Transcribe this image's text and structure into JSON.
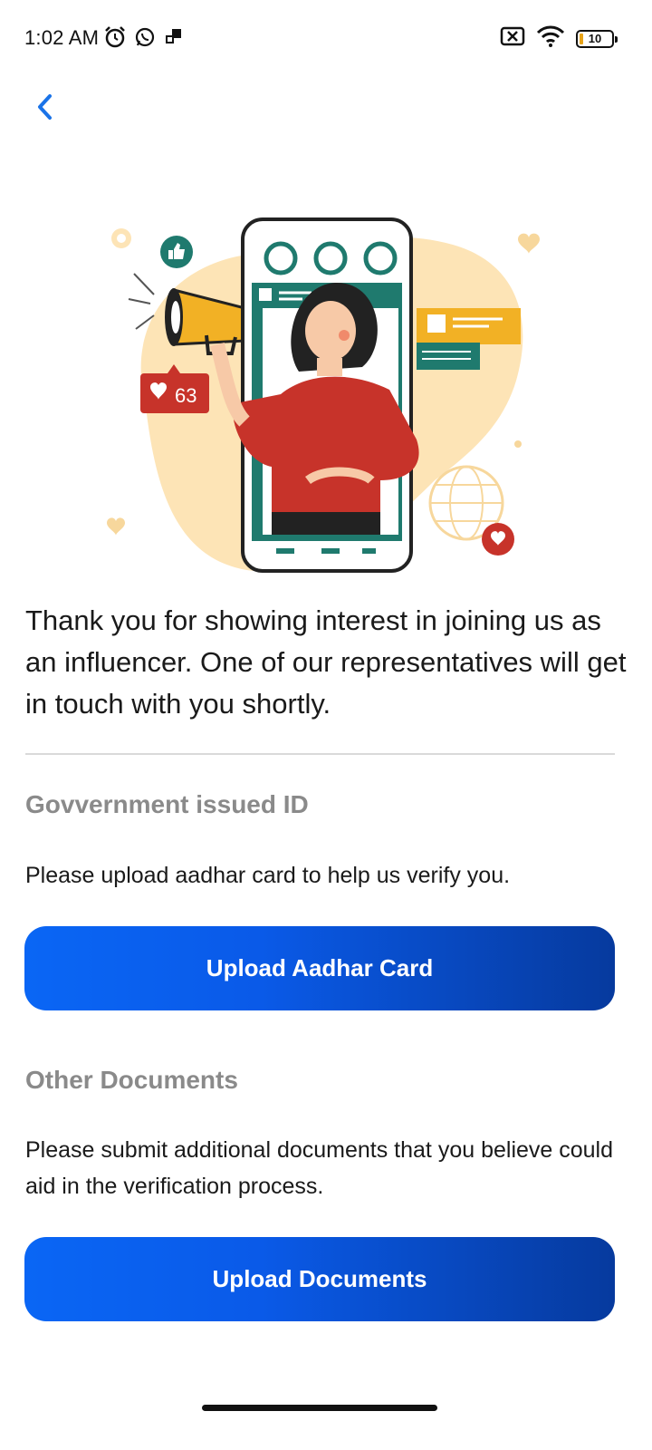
{
  "status_bar": {
    "time": "1:02 AM",
    "battery_level": "10",
    "icons": [
      "alarm-icon",
      "whatsapp-icon",
      "notification-icon",
      "no-sim-icon",
      "wifi-icon",
      "battery-icon"
    ]
  },
  "nav": {
    "back_icon": "chevron-left-icon",
    "accent_color": "#1a73e8"
  },
  "illustration": {
    "like_count": "63"
  },
  "intro_text": "Thank you for showing interest in joining us as an influencer. One of our representatives will get in touch with you shortly.",
  "sections": [
    {
      "title": "Govvernment issued ID",
      "description": "Please upload aadhar card to help us verify you.",
      "button_label": "Upload Aadhar Card"
    },
    {
      "title": "Other Documents",
      "description": "Please submit additional documents that you believe could aid in the verification process.",
      "button_label": "Upload Documents"
    }
  ],
  "colors": {
    "button_gradient_start": "#0a66f5",
    "button_gradient_end": "#063a9e",
    "section_title": "#8a8a8a"
  }
}
